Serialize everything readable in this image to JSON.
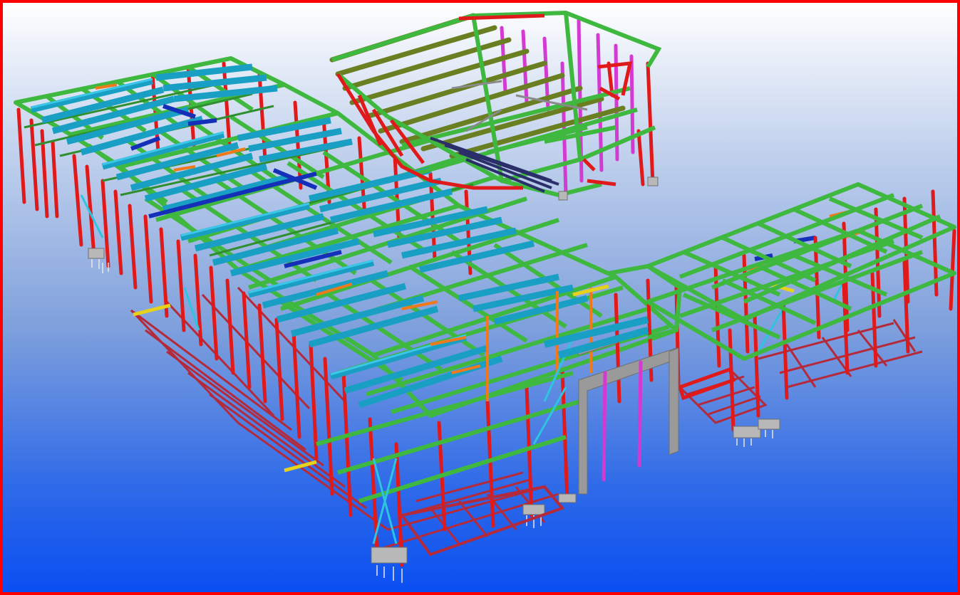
{
  "viewport": {
    "border_color": "#ff0000",
    "background_top": "#ffffff",
    "background_bottom": "#0a4ff2"
  },
  "model": {
    "description_colors": {
      "primary_beam": "#3fb83f",
      "primary_beam_dark": "#2f8f2f",
      "secondary_beam": "#1a9fc4",
      "secondary_beam_light": "#3cc6e8",
      "column": "#e01a1a",
      "column_dark": "#a80f0f",
      "foundation": "#b52a3a",
      "brace": "#2ec4e0",
      "purlin_dark": "#1530b8",
      "olive_rafter": "#6a7f22",
      "magenta_column": "#d23ad2",
      "orange_member": "#f07a1a",
      "yellow_member": "#e6d21a",
      "grey_frame": "#9a9a9a",
      "footing_grey": "#b8b8b8"
    }
  }
}
